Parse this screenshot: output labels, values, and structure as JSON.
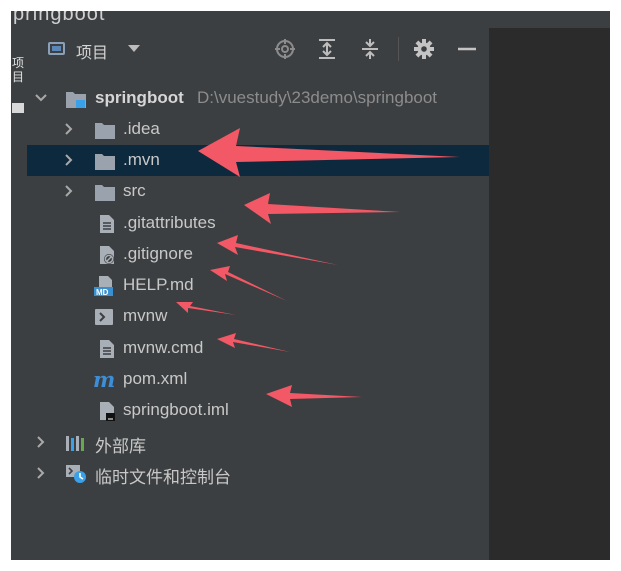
{
  "title_fragment": "pringboot",
  "left_strip": {
    "label": "项目"
  },
  "header": {
    "title": "项目",
    "icons": [
      "view-mode-icon",
      "dropdown-caret-icon",
      "locate-icon",
      "expand-all-icon",
      "collapse-all-icon",
      "settings-gear-icon",
      "minimize-icon"
    ]
  },
  "tree": {
    "root": {
      "name": "springboot",
      "path": "D:\\vuestudy\\23demo\\springboot"
    },
    "items": [
      {
        "name": ".idea",
        "type": "folder"
      },
      {
        "name": ".mvn",
        "type": "folder",
        "selected": true
      },
      {
        "name": "src",
        "type": "folder"
      },
      {
        "name": ".gitattributes",
        "type": "text-file"
      },
      {
        "name": ".gitignore",
        "type": "ignore-file"
      },
      {
        "name": "HELP.md",
        "type": "markdown-file"
      },
      {
        "name": "mvnw",
        "type": "shell-script"
      },
      {
        "name": "mvnw.cmd",
        "type": "text-file"
      },
      {
        "name": "pom.xml",
        "type": "maven-pom"
      },
      {
        "name": "springboot.iml",
        "type": "module-file"
      }
    ],
    "external_libraries": "外部库",
    "scratches": "临时文件和控制台"
  },
  "colors": {
    "background": "#3c3f41",
    "selection": "#0d293e",
    "text": "#c8c8c8",
    "annotation_arrow": "#f25865"
  }
}
